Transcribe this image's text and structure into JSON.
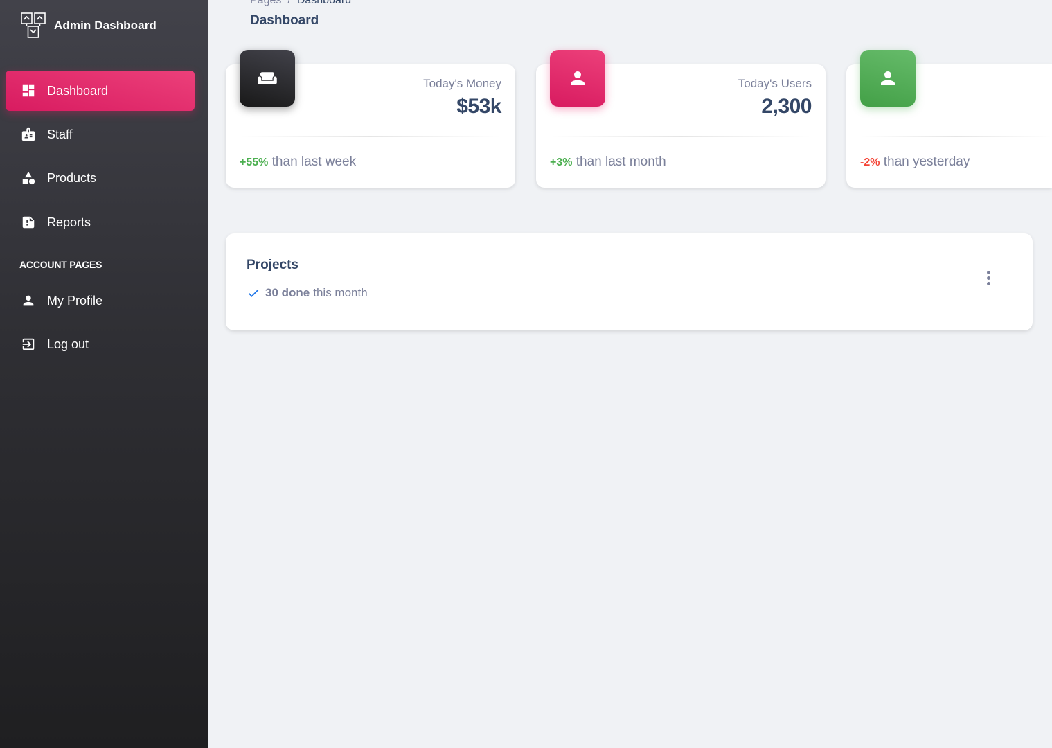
{
  "brand": {
    "title": "Admin Dashboard"
  },
  "sidebar": {
    "items": [
      {
        "label": "Dashboard",
        "icon": "dashboard-icon",
        "active": true
      },
      {
        "label": "Staff",
        "icon": "badge-icon"
      },
      {
        "label": "Products",
        "icon": "shapes-icon"
      },
      {
        "label": "Reports",
        "icon": "report-icon"
      }
    ],
    "section_label": "ACCOUNT PAGES",
    "account_items": [
      {
        "label": "My Profile",
        "icon": "person-icon"
      },
      {
        "label": "Log out",
        "icon": "logout-icon"
      }
    ]
  },
  "header": {
    "breadcrumb": {
      "parent": "Pages",
      "separator": "/",
      "current": "Dashboard"
    },
    "title": "Dashboard"
  },
  "stats": [
    {
      "icon": "weekend-icon",
      "color": "#191919",
      "label": "Today's Money",
      "value": "$53k",
      "change": "+55%",
      "change_dir": "up",
      "suffix": " than last week"
    },
    {
      "icon": "person-icon",
      "color": "#d81b60",
      "label": "Today's Users",
      "value": "2,300",
      "change": "+3%",
      "change_dir": "up",
      "suffix": " than last month"
    },
    {
      "icon": "person-icon",
      "color": "#43a047",
      "label": "",
      "value": "",
      "change": "-2%",
      "change_dir": "down",
      "suffix": " than yesterday"
    }
  ],
  "projects": {
    "title": "Projects",
    "done": "30 done",
    "period": "this month",
    "check_color": "#1a73e8"
  },
  "colors": {
    "accent": "#e91e63",
    "success": "#4caf50",
    "danger": "#f44335",
    "text_primary": "#344767",
    "text_secondary": "#7b809a"
  }
}
